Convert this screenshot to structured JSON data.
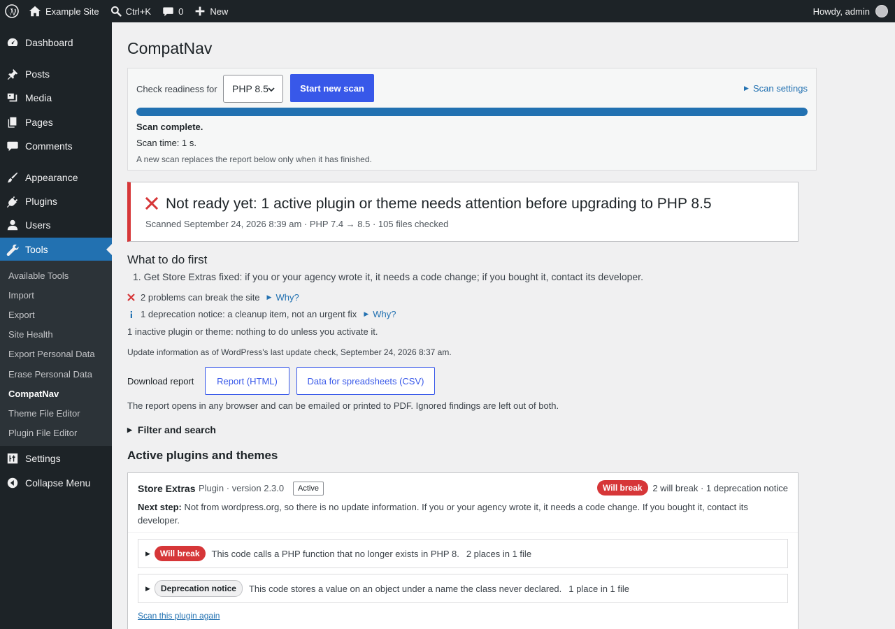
{
  "adminbar": {
    "site_name": "Example Site",
    "search_shortcut": "Ctrl+K",
    "comments_count": "0",
    "new_label": "New",
    "howdy": "Howdy, admin"
  },
  "sidebar": {
    "dashboard": "Dashboard",
    "posts": "Posts",
    "media": "Media",
    "pages": "Pages",
    "comments": "Comments",
    "appearance": "Appearance",
    "plugins": "Plugins",
    "users": "Users",
    "tools": "Tools",
    "settings": "Settings",
    "collapse": "Collapse Menu",
    "submenu": [
      "Available Tools",
      "Import",
      "Export",
      "Site Health",
      "Export Personal Data",
      "Erase Personal Data",
      "CompatNav",
      "Theme File Editor",
      "Plugin File Editor"
    ]
  },
  "page": {
    "title": "CompatNav"
  },
  "scan": {
    "check_label": "Check readiness for",
    "php_version": "PHP 8.5",
    "start_button": "Start new scan",
    "settings_link": "Scan settings",
    "progress_percent": 100,
    "status": "Scan complete.",
    "time": "Scan time: 1 s.",
    "note": "A new scan replaces the report below only when it has finished."
  },
  "verdict": {
    "headline": "Not ready yet: 1 active plugin or theme needs attention before upgrading to PHP 8.5",
    "meta": "Scanned September 24, 2026 8:39 am · PHP 7.4 → 8.5 · 105 files checked"
  },
  "what_first": {
    "heading": "What to do first",
    "step1": "1. Get Store Extras fixed: if you or your agency wrote it, it needs a code change; if you bought it, contact its developer.",
    "problems": "2 problems can break the site",
    "notice": "1 deprecation notice: a cleanup item, not an urgent fix",
    "why_label": "Why?",
    "inactive": "1 inactive plugin or theme: nothing to do unless you activate it.",
    "update_info": "Update information as of WordPress's last update check, September 24, 2026 8:37 am."
  },
  "download": {
    "label": "Download report",
    "html_button": "Report (HTML)",
    "csv_button": "Data for spreadsheets (CSV)",
    "note": "The report opens in any browser and can be emailed or printed to PDF. Ignored findings are left out of both."
  },
  "filter": {
    "label": "Filter and search"
  },
  "active_section": {
    "heading": "Active plugins and themes"
  },
  "plugin": {
    "name": "Store Extras",
    "type_version": "Plugin · version 2.3.0",
    "status": "Active",
    "badge": "Will break",
    "summary": "2 will break · 1 deprecation notice",
    "next_step_label": "Next step:",
    "next_step_text": " Not from wordpress.org, so there is no update information. If you or your agency wrote it, it needs a code change. If you bought it, contact its developer.",
    "findings": [
      {
        "badge": "Will break",
        "description": "This code calls a PHP function that no longer exists in PHP 8.",
        "count": "2 places in 1 file"
      },
      {
        "badge": "Deprecation notice",
        "description": "This code stores a value on an object under a name the class never declared.",
        "count": "1 place in 1 file"
      }
    ],
    "rescan_link": "Scan this plugin again"
  },
  "colors": {
    "adminbar_bg": "#1d2327",
    "accent": "#2271b1",
    "primary_button": "#3858e9",
    "error": "#d63638"
  }
}
